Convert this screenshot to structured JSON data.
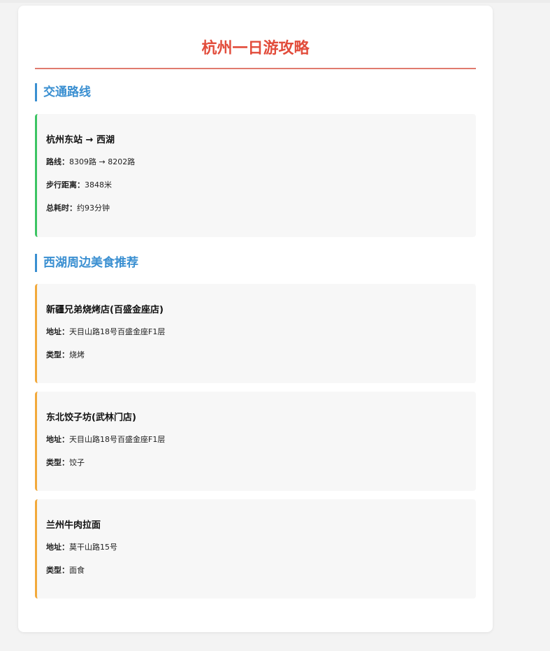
{
  "page": {
    "title": "杭州一日游攻略"
  },
  "transport": {
    "heading": "交通路线",
    "route_title": "杭州东站 → 西湖",
    "rows": [
      {
        "label": "路线：",
        "value": "8309路 → 8202路"
      },
      {
        "label": "步行距离：",
        "value": "3848米"
      },
      {
        "label": "总耗时：",
        "value": "约93分钟"
      }
    ]
  },
  "food": {
    "heading": "西湖周边美食推荐",
    "restaurants": [
      {
        "name": "新疆兄弟烧烤店(百盛金座店)",
        "address_label": "地址：",
        "address": "天目山路18号百盛金座F1层",
        "type_label": "类型：",
        "type": "烧烤"
      },
      {
        "name": "东北饺子坊(武林门店)",
        "address_label": "地址：",
        "address": "天目山路18号百盛金座F1层",
        "type_label": "类型：",
        "type": "饺子"
      },
      {
        "name": "兰州牛肉拉面",
        "address_label": "地址：",
        "address": "莫干山路15号",
        "type_label": "类型：",
        "type": "面食"
      }
    ]
  },
  "colors": {
    "title": "#e24c3b",
    "heading": "#3a8fd1",
    "route_accent": "#3cc463",
    "food_accent": "#f2a93b"
  }
}
